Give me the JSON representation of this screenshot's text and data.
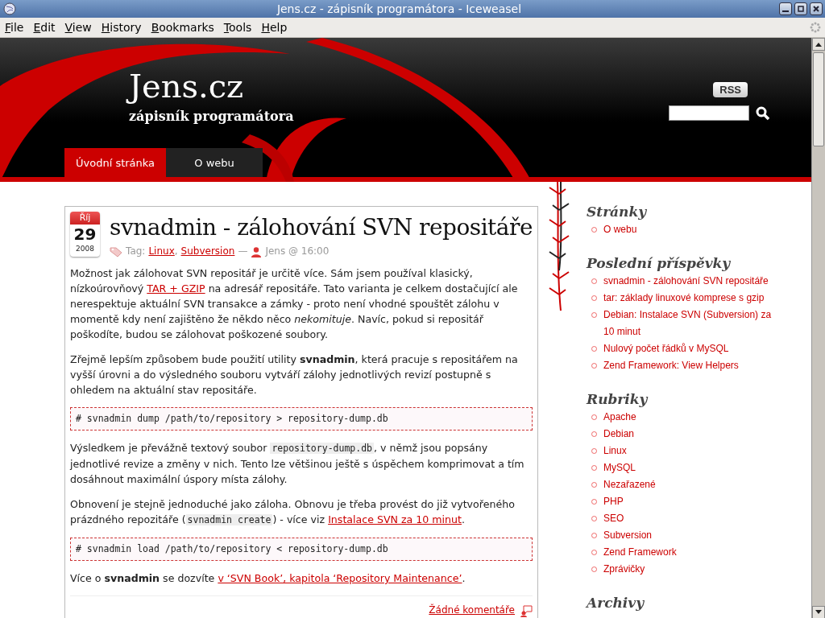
{
  "window": {
    "title": "Jens.cz - zápisník programátora - Iceweasel"
  },
  "menu": [
    {
      "label": "File"
    },
    {
      "label": "Edit"
    },
    {
      "label": "View"
    },
    {
      "label": "History"
    },
    {
      "label": "Bookmarks"
    },
    {
      "label": "Tools"
    },
    {
      "label": "Help"
    }
  ],
  "header": {
    "site_title": "Jens.cz",
    "tagline": "zápisník programátora",
    "rss": "RSS",
    "tabs": [
      {
        "label": "Úvodní stránka",
        "selected": true
      },
      {
        "label": "O webu",
        "selected": false
      }
    ]
  },
  "post": {
    "date": {
      "month": "Říj",
      "day": "29",
      "year": "2008"
    },
    "title": "svnadmin - zálohování SVN repositáře",
    "meta": {
      "tag_label": "Tag:",
      "tags": [
        "Linux",
        "Subversion"
      ],
      "tag_separator": ",",
      "separator": "—",
      "author_time": "Jens @ 16:00"
    },
    "body": [
      {
        "kind": "paragraph",
        "parts": [
          {
            "kind": "text",
            "text": "Možnost jak zálohovat SVN repositář je určitě více. Sám jsem používal klasický, nízkoúrovňový "
          },
          {
            "kind": "link",
            "text": "TAR + GZIP"
          },
          {
            "kind": "text",
            "text": " na adresář repositáře. Tato varianta je celkem dostačující ale nerespektuje aktuální SVN transakce a zámky - proto není vhodné spouštět zálohu v momentě kdy není zajištěno že někdo něco *nekomituje*. Navíc, pokud si repositář poškodíte, budou se zálohovat poškozené soubory."
          }
        ]
      },
      {
        "kind": "paragraph",
        "parts": [
          {
            "kind": "text",
            "text": "Zřejmě lepším způsobem bude použití utility **svnadmin**, která pracuje s repositářem na vyšší úrovni a do výsledného souboru vytváří zálohy jednotlivých revizí postupně s ohledem na aktuální stav repositáře."
          }
        ]
      },
      {
        "kind": "code",
        "text": "# svnadmin dump /path/to/repository > repository-dump.db"
      },
      {
        "kind": "paragraph",
        "parts": [
          {
            "kind": "text",
            "text": "Výsledkem je převážně textový soubor "
          },
          {
            "kind": "code",
            "text": "repository-dump.db"
          },
          {
            "kind": "text",
            "text": ", v němž jsou popsány jednotlivé revize a změny v nich. Tento lze většinou ještě s úspěchem komprimovat a tím dosáhnout maximální úspory místa zálohy."
          }
        ]
      },
      {
        "kind": "paragraph",
        "parts": [
          {
            "kind": "text",
            "text": "Obnovení je stejně jednoduché jako záloha. Obnovu je třeba provést do již vytvořeného prázdného repozitáře ("
          },
          {
            "kind": "code",
            "text": "svnadmin create"
          },
          {
            "kind": "text",
            "text": ") - více viz "
          },
          {
            "kind": "link",
            "text": "Instalace SVN za 10 minut"
          },
          {
            "kind": "text",
            "text": "."
          }
        ]
      },
      {
        "kind": "code",
        "text": "# svnadmin load /path/to/repository < repository-dump.db"
      },
      {
        "kind": "paragraph",
        "parts": [
          {
            "kind": "text",
            "text": "Více o **svnadmin** se dozvíte "
          },
          {
            "kind": "link",
            "text": "v ‘SVN Book’, kapitola ‘Repository Maintenance’"
          },
          {
            "kind": "text",
            "text": "."
          }
        ]
      }
    ],
    "comments": "Žádné komentáře"
  },
  "sidebar": [
    {
      "heading": "Stránky",
      "items": [
        "O webu"
      ]
    },
    {
      "heading": "Poslední příspěvky",
      "items": [
        "svnadmin - zálohování SVN repositáře",
        "tar: základy linuxové komprese s gzip",
        "Debian: Instalace SVN (Subversion) za 10 minut",
        "Nulový počet řádků v MySQL",
        "Zend Framework: View Helpers"
      ]
    },
    {
      "heading": "Rubriky",
      "items": [
        "Apache",
        "Debian",
        "Linux",
        "MySQL",
        "Nezařazené",
        "PHP",
        "SEO",
        "Subversion",
        "Zend Framework",
        "Zprávičky"
      ]
    },
    {
      "heading": "Archivy"
    }
  ]
}
